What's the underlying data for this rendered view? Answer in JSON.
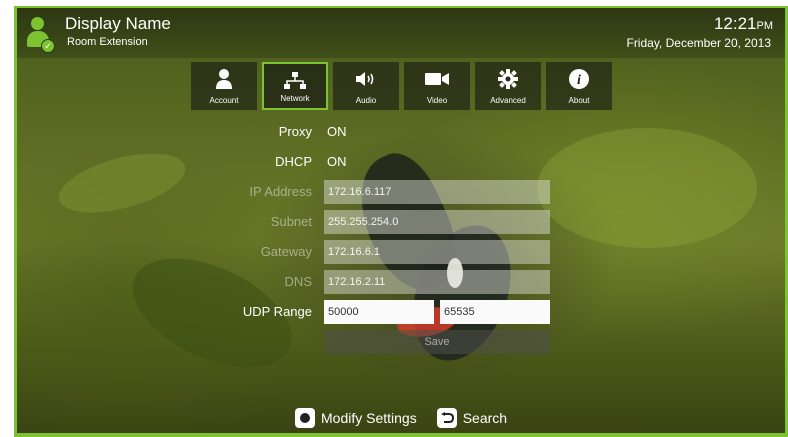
{
  "header": {
    "display_name": "Display Name",
    "room_extension": "Room Extension",
    "time": "12:21",
    "ampm": "PM",
    "date": "Friday, December 20, 2013"
  },
  "tabs": [
    {
      "label": "Account",
      "icon": "user-icon"
    },
    {
      "label": "Network",
      "icon": "network-icon",
      "active": true
    },
    {
      "label": "Audio",
      "icon": "speaker-icon"
    },
    {
      "label": "Video",
      "icon": "camera-icon"
    },
    {
      "label": "Advanced",
      "icon": "gear-icon"
    },
    {
      "label": "About",
      "icon": "info-icon"
    }
  ],
  "form": {
    "proxy_label": "Proxy",
    "proxy_value": "ON",
    "dhcp_label": "DHCP",
    "dhcp_value": "ON",
    "ip_label": "IP Address",
    "ip_value": "172.16.6.117",
    "subnet_label": "Subnet",
    "subnet_value": "255.255.254.0",
    "gateway_label": "Gateway",
    "gateway_value": "172.16.6.1",
    "dns_label": "DNS",
    "dns_value": "172.16.2.11",
    "udp_label": "UDP Range",
    "udp_start": "50000",
    "udp_end": "65535",
    "save_label": "Save"
  },
  "hints": {
    "modify": "Modify Settings",
    "search": "Search"
  },
  "colors": {
    "accent": "#7cc231"
  }
}
